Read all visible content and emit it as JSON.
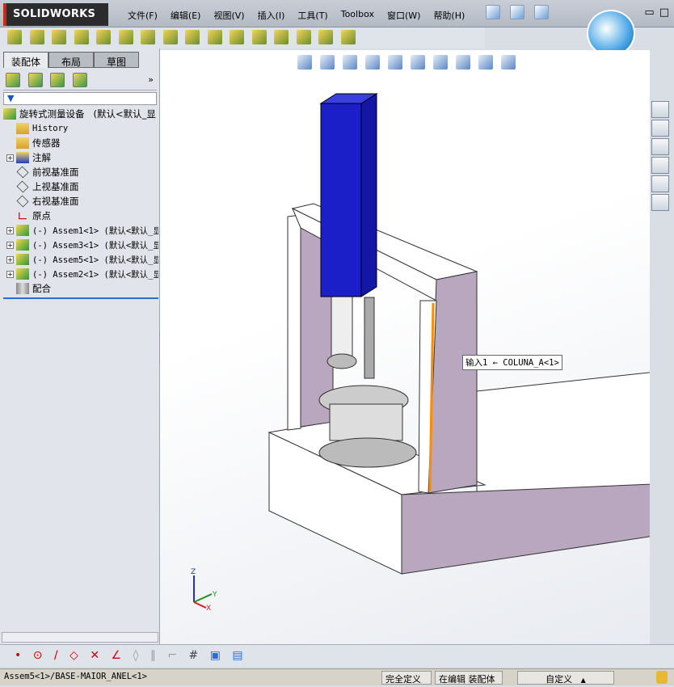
{
  "app": {
    "logo": "SOLIDWORKS"
  },
  "menu": [
    "文件(F)",
    "编辑(E)",
    "视图(V)",
    "插入(I)",
    "工具(T)",
    "Toolbox",
    "窗口(W)",
    "帮助(H)"
  ],
  "tabs": [
    {
      "label": "装配体",
      "active": true
    },
    {
      "label": "布局",
      "active": false
    },
    {
      "label": "草图",
      "active": false
    }
  ],
  "filter_icon": "funnel-icon",
  "tree": {
    "root": {
      "label": "旋转式测量设备",
      "config": "(默认<默认_显"
    },
    "items": [
      {
        "label": "History",
        "icon": "history-folder-icon",
        "expandable": false,
        "mono": true
      },
      {
        "label": "传感器",
        "icon": "sensor-folder-icon",
        "expandable": false
      },
      {
        "label": "注解",
        "icon": "annotation-folder-icon",
        "expandable": true
      },
      {
        "label": "前视基准面",
        "icon": "plane-icon",
        "expandable": false
      },
      {
        "label": "上视基准面",
        "icon": "plane-icon",
        "expandable": false
      },
      {
        "label": "右视基准面",
        "icon": "plane-icon",
        "expandable": false
      },
      {
        "label": "原点",
        "icon": "origin-icon",
        "expandable": false
      },
      {
        "label": "(-) Assem1<1> (默认<默认_显",
        "icon": "assembly-icon",
        "expandable": true,
        "mono": true
      },
      {
        "label": "(-) Assem3<1> (默认<默认_显",
        "icon": "assembly-icon",
        "expandable": true,
        "mono": true
      },
      {
        "label": "(-) Assem5<1> (默认<默认_显",
        "icon": "assembly-icon",
        "expandable": true,
        "mono": true
      },
      {
        "label": "(-) Assem2<1> (默认<默认_显",
        "icon": "assembly-icon",
        "expandable": true,
        "mono": true
      },
      {
        "label": "配合",
        "icon": "mates-icon",
        "expandable": false
      }
    ]
  },
  "callout": "输入1 ← COLUNA_A<1>",
  "triad": {
    "x": "X",
    "y": "Y",
    "z": "Z"
  },
  "status": {
    "path": "Assem5<1>/BASE-MAIOR_ANEL<1>",
    "defined": "完全定义",
    "editing": "在编辑 装配体",
    "units": "自定义",
    "units_arrow": "▲"
  },
  "colors": {
    "column": "#1a1fc8",
    "frame_side": "#b9a6bf",
    "highlight": "#ff8c00",
    "accent": "#2a6dd4"
  }
}
